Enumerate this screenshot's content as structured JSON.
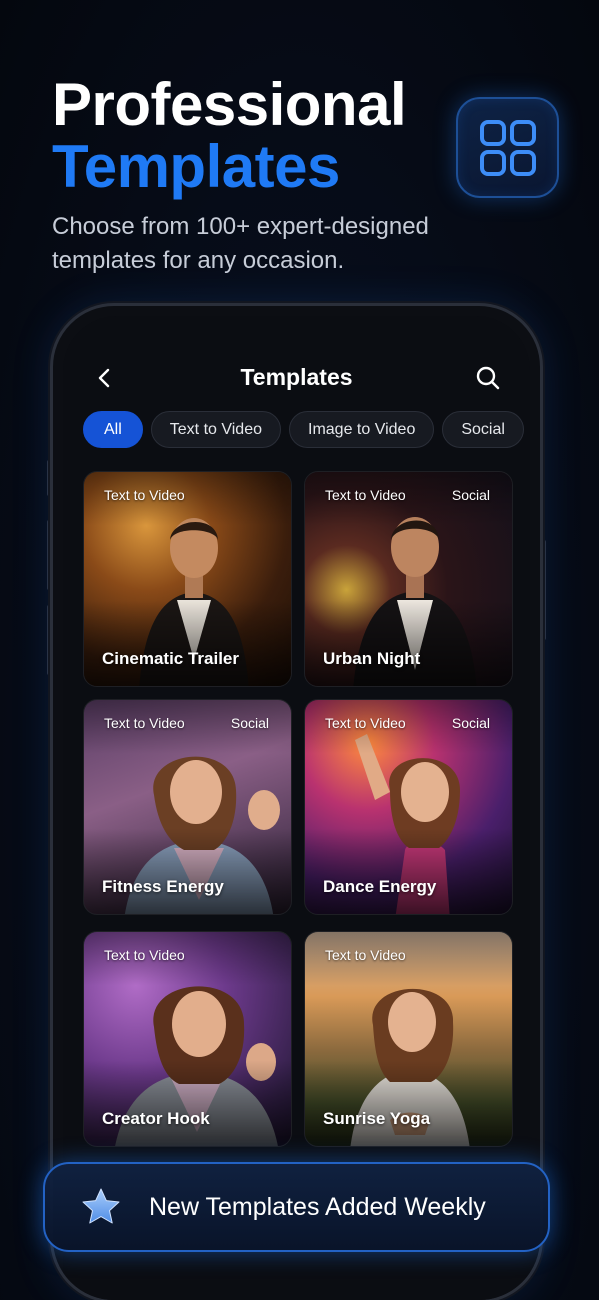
{
  "hero": {
    "title_line1": "Professional",
    "title_line2": "Templates",
    "subtitle": "Choose from 100+ expert-designed templates for any occasion.",
    "badge_icon": "grid-icon",
    "accent_color": "#1f7af5"
  },
  "app": {
    "nav": {
      "back_icon": "chevron-left-icon",
      "title": "Templates",
      "search_icon": "search-icon"
    },
    "filters": [
      {
        "label": "All",
        "active": true
      },
      {
        "label": "Text to Video",
        "active": false
      },
      {
        "label": "Image to Video",
        "active": false
      },
      {
        "label": "Social",
        "active": false
      }
    ],
    "templates": [
      {
        "name": "Cinematic Trailer",
        "tags": [
          "Text to Video"
        ]
      },
      {
        "name": "Urban Night",
        "tags": [
          "Text to Video",
          "Social"
        ]
      },
      {
        "name": "Fitness Energy",
        "tags": [
          "Text to Video",
          "Social"
        ]
      },
      {
        "name": "Dance Energy",
        "tags": [
          "Text to Video",
          "Social"
        ]
      },
      {
        "name": "Creator Hook",
        "tags": [
          "Text to Video"
        ]
      },
      {
        "name": "Sunrise Yoga",
        "tags": [
          "Text to Video"
        ]
      }
    ]
  },
  "banner": {
    "icon": "star-icon",
    "text": "New Templates Added Weekly"
  }
}
